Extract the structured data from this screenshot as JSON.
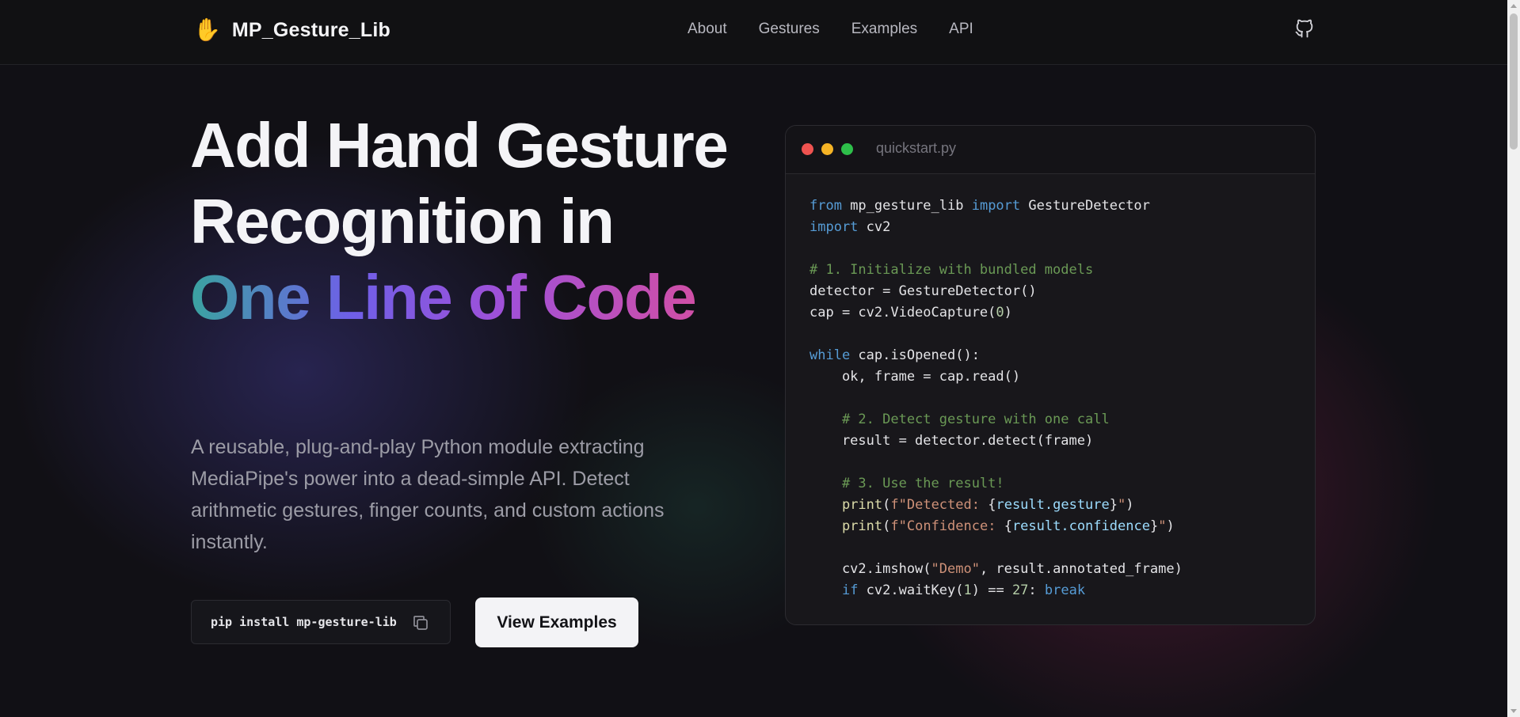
{
  "nav": {
    "logo_icon": "✋",
    "title": "MP_Gesture_Lib",
    "links": [
      "About",
      "Gestures",
      "Examples",
      "API"
    ],
    "github_icon": "github-icon"
  },
  "hero": {
    "headline_plain": "Add Hand Gesture Recognition in",
    "headline_gradient": "One Line of Code",
    "subtitle": "A reusable, plug-and-play Python module extracting MediaPipe's power into a dead-simple API. Detect arithmetic gestures, finger counts, and custom actions instantly.",
    "install_command": "pip install mp-gesture-lib",
    "copy_icon": "copy-icon",
    "examples_button": "View Examples"
  },
  "code_window": {
    "filename": "quickstart.py",
    "lines": [
      "from mp_gesture_lib import GestureDetector",
      "import cv2",
      "",
      "# 1. Initialize with bundled models",
      "detector = GestureDetector()",
      "cap = cv2.VideoCapture(0)",
      "",
      "while cap.isOpened():",
      "    ok, frame = cap.read()",
      "",
      "    # 2. Detect gesture with one call",
      "    result = detector.detect(frame)",
      "",
      "    # 3. Use the result!",
      "    print(f\"Detected: {result.gesture}\")",
      "    print(f\"Confidence: {result.confidence}\")",
      "",
      "    cv2.imshow(\"Demo\", result.annotated_frame)",
      "    if cv2.waitKey(1) == 27: break"
    ]
  },
  "colors": {
    "gradient_start": "#3aa3a0",
    "gradient_mid": "#6f5fe8",
    "gradient_end": "#d04fa6",
    "keyword": "#569cd6",
    "comment": "#6a9955"
  }
}
